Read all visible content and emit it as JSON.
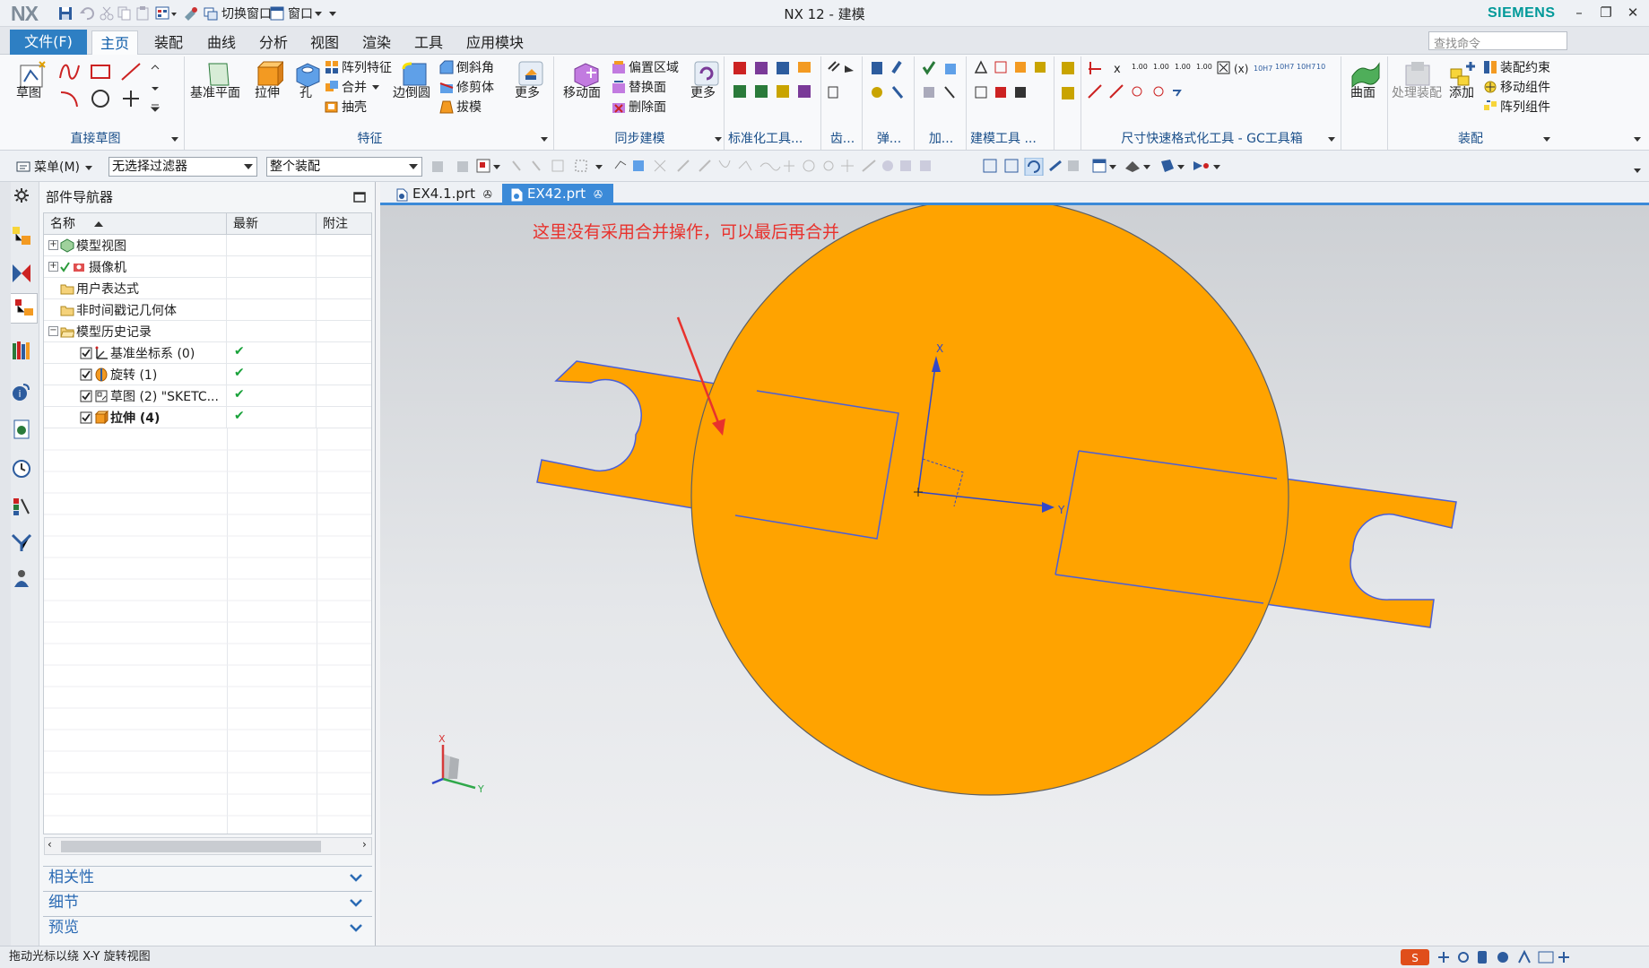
{
  "titlebar": {
    "logo": "NX",
    "title": "NX 12 - 建模",
    "brand": "SIEMENS",
    "switch_window": "切换窗口",
    "window_menu": "窗口"
  },
  "menubar": {
    "file": "文件(F)",
    "tabs": [
      "主页",
      "装配",
      "曲线",
      "分析",
      "视图",
      "渲染",
      "工具",
      "应用模块"
    ],
    "search_placeholder": "查找命令"
  },
  "ribbon": {
    "sketch": {
      "label": "草图",
      "group": "直接草图"
    },
    "feature": {
      "datum_plane": "基准平面",
      "extrude": "拉伸",
      "hole": "孔",
      "pattern": "阵列特征",
      "unite": "合并",
      "shell": "抽壳",
      "edge_blend": "边倒圆",
      "chamfer": "倒斜角",
      "trim_body": "修剪体",
      "draft": "拔模",
      "more": "更多",
      "group": "特征"
    },
    "sync": {
      "move_face": "移动面",
      "offset_region": "偏置区域",
      "replace_face": "替换面",
      "delete_face": "删除面",
      "more": "更多",
      "group": "同步建模"
    },
    "small_groups": [
      "标准化工具...",
      "齿...",
      "弹...",
      "加...",
      "建模工具 ...",
      "尺寸快速格式化工具 - GC工具箱"
    ],
    "surface": {
      "label": "曲面"
    },
    "assembly": {
      "process": "处理装配",
      "add": "添加",
      "constraint": "装配约束",
      "move_comp": "移动组件",
      "pattern_comp": "阵列组件",
      "group": "装配"
    }
  },
  "toolbar": {
    "menu": "菜单(M)",
    "filter": "无选择过滤器",
    "scope": "整个装配"
  },
  "navigator": {
    "title": "部件导航器",
    "columns": [
      "名称",
      "最新",
      "附注"
    ],
    "rows": [
      {
        "label": "模型视图",
        "check": false,
        "latest": ""
      },
      {
        "label": "摄像机",
        "check": false,
        "latest": ""
      },
      {
        "label": "用户表达式",
        "check": false,
        "latest": ""
      },
      {
        "label": "非时间戳记几何体",
        "check": false,
        "latest": ""
      },
      {
        "label": "模型历史记录",
        "check": false,
        "latest": ""
      },
      {
        "label": "基准坐标系 (0)",
        "check": true,
        "latest": "✔"
      },
      {
        "label": "旋转 (1)",
        "check": true,
        "latest": "✔"
      },
      {
        "label": "草图 (2) \"SKETC...",
        "check": true,
        "latest": "✔"
      },
      {
        "label": "拉伸 (4)",
        "check": true,
        "latest": "✔"
      }
    ],
    "panels": [
      "相关性",
      "细节",
      "预览"
    ]
  },
  "doc_tabs": [
    "EX4.1.prt",
    "EX42.prt"
  ],
  "viewport": {
    "annotation": "这里没有采用合并操作，可以最后再合并",
    "csys_x": "X",
    "csys_y": "Y",
    "triad_x": "X",
    "triad_y": "Y",
    "model_color": "#ffa300",
    "edge_color": "#4a5fd8",
    "annotation_color": "#e8322d"
  },
  "statusbar": {
    "text": "拖动光标以绕 X-Y 旋转视图"
  }
}
